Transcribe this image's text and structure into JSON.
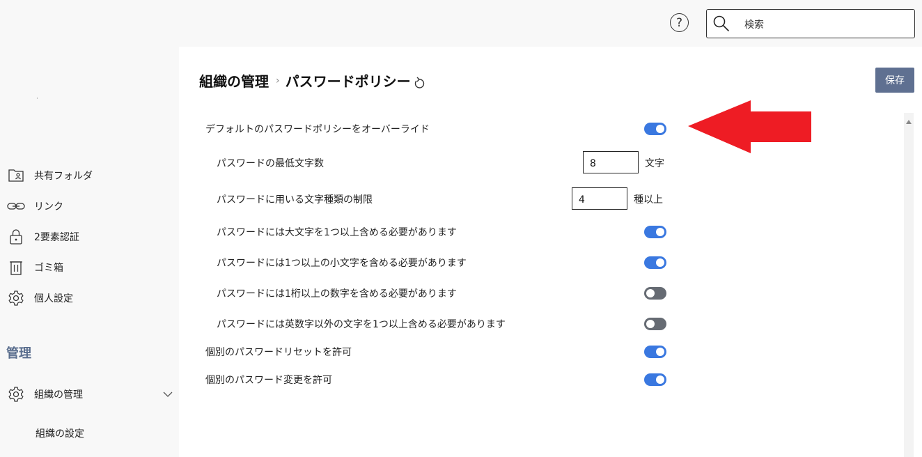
{
  "header": {
    "help_label": "?",
    "search_placeholder": "検索"
  },
  "sidebar": {
    "items": [
      {
        "label": "共有フォルダ",
        "icon": "shared-folder-icon"
      },
      {
        "label": "リンク",
        "icon": "link-icon"
      },
      {
        "label": "2要素認証",
        "icon": "lock-icon"
      },
      {
        "label": "ゴミ箱",
        "icon": "trash-icon"
      },
      {
        "label": "個人設定",
        "icon": "gear-icon"
      }
    ],
    "admin_title": "管理",
    "admin_items": [
      {
        "label": "組織の管理",
        "icon": "gear-icon"
      }
    ],
    "admin_subitems": [
      {
        "label": "組織の設定"
      }
    ]
  },
  "main": {
    "breadcrumb": {
      "parent": "組織の管理",
      "separator": "›",
      "current": "パスワードポリシー"
    },
    "save_label": "保存",
    "settings": {
      "override": {
        "label": "デフォルトのパスワードポリシーをオーバーライド",
        "enabled": true
      },
      "min_length": {
        "label": "パスワードの最低文字数",
        "value": "8",
        "unit": "文字"
      },
      "char_types": {
        "label": "パスワードに用いる文字種類の制限",
        "value": "4",
        "unit": "種以上"
      },
      "uppercase": {
        "label": "パスワードには大文字を1つ以上含める必要があります",
        "enabled": true
      },
      "lowercase": {
        "label": "パスワードには1つ以上の小文字を含める必要があります",
        "enabled": true
      },
      "digits": {
        "label": "パスワードには1桁以上の数字を含める必要があります",
        "enabled": false
      },
      "symbols": {
        "label": "パスワードには英数字以外の文字を1つ以上含める必要があります",
        "enabled": false
      },
      "allow_reset": {
        "label": "個別のパスワードリセットを許可",
        "enabled": true
      },
      "allow_change": {
        "label": "個別のパスワード変更を許可",
        "enabled": true
      }
    }
  },
  "colors": {
    "toggle_on": "#3a78e0",
    "toggle_off": "#666b73",
    "save_button": "#5f7091",
    "admin_title": "#5a6e8e",
    "annotation_arrow": "#ee1c24"
  }
}
